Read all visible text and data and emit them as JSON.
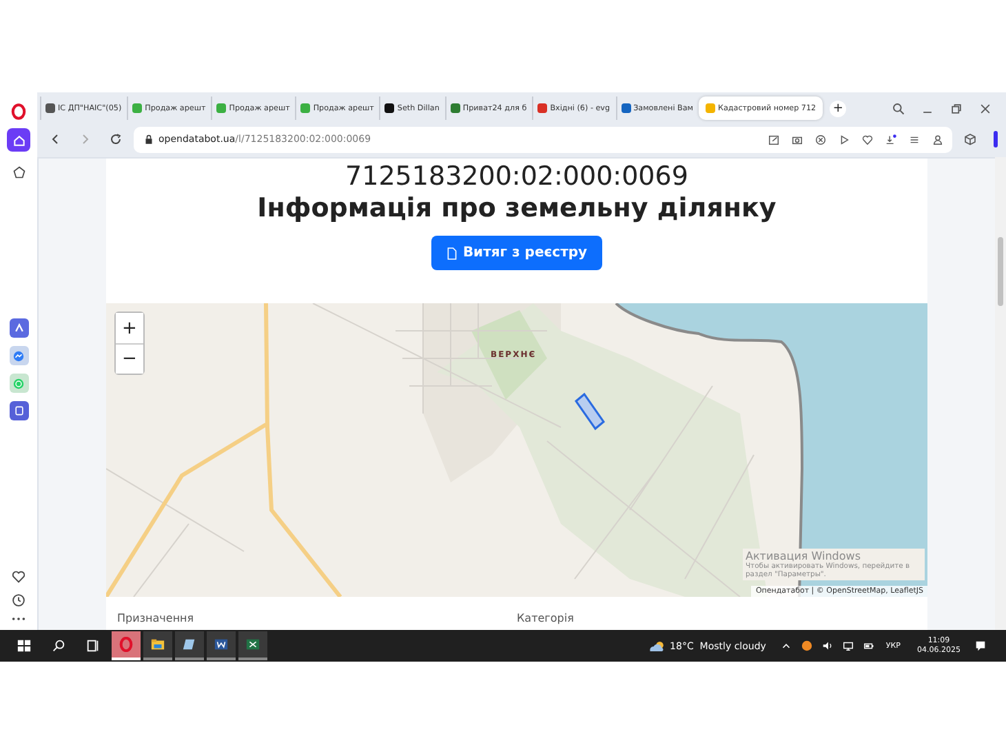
{
  "browser": {
    "sidebar": [
      {
        "kind": "home",
        "selected": true
      },
      {
        "kind": "bookmarks",
        "selected": false
      }
    ],
    "tabs": [
      {
        "label": "ІС ДП\"НАІС\"(05)",
        "color": "#555555",
        "selected": false
      },
      {
        "label": "Продаж арешт",
        "color": "#3cb043",
        "selected": false
      },
      {
        "label": "Продаж арешт",
        "color": "#3cb043",
        "selected": false
      },
      {
        "label": "Продаж арешт",
        "color": "#3cb043",
        "selected": false
      },
      {
        "label": "Seth Dillan",
        "color": "#111111",
        "selected": false
      },
      {
        "label": "Приват24 для б",
        "color": "#2e7d32",
        "selected": false
      },
      {
        "label": "Вхідні (6) - evg",
        "color": "#d93025",
        "selected": false
      },
      {
        "label": "Замовлені Вам",
        "color": "#1565c0",
        "selected": false
      },
      {
        "label": "Кадастровий номер 712",
        "color": "#f4b400",
        "selected": true
      }
    ],
    "new_tab": "+",
    "address": {
      "domain": "opendatabot.ua",
      "path": "/l/7125183200:02:000:0069"
    }
  },
  "page": {
    "cadastral_number": "7125183200:02:000:0069",
    "heading": "Інформація про земельну ділянку",
    "extract_button": "Витяг з реєстру",
    "map": {
      "zoom_in": "+",
      "zoom_out": "−",
      "place_label": "ВЕРХНЄ",
      "attribution": "Опендатабот | © OpenStreetMap, LeafletJS"
    },
    "fields": [
      "Призначення",
      "Категорія"
    ]
  },
  "os_overlay": {
    "title": "Активация Windows",
    "text": "Чтобы активировать Windows, перейдите в раздел \"Параметры\"."
  },
  "taskbar": {
    "apps": [
      {
        "kind": "opera",
        "selected": true
      },
      {
        "kind": "explorer",
        "selected": false
      },
      {
        "kind": "notepad",
        "selected": false
      },
      {
        "kind": "word",
        "selected": false
      },
      {
        "kind": "excel",
        "selected": false
      }
    ],
    "weather": "18°C  Mostly cloudy",
    "language": "УКР",
    "time": "11:09",
    "date": "04.06.2025"
  }
}
